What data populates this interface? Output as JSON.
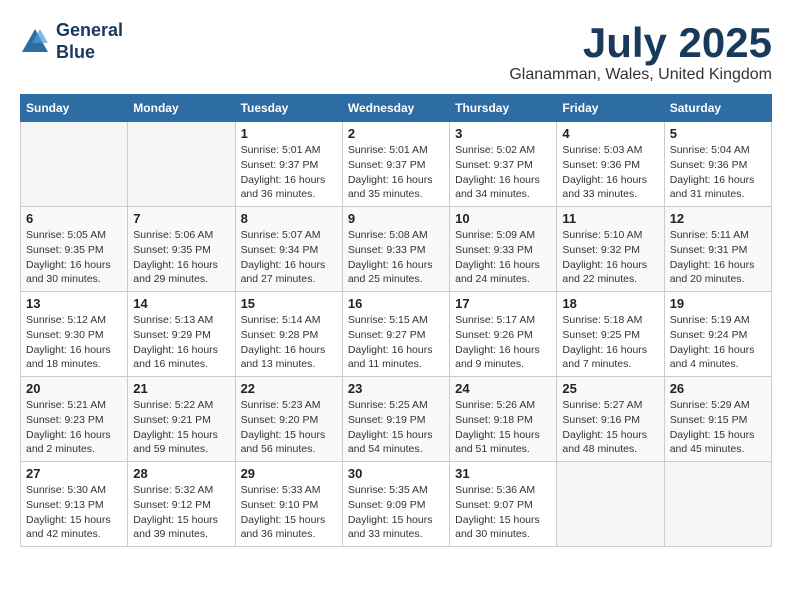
{
  "logo": {
    "line1": "General",
    "line2": "Blue"
  },
  "title": "July 2025",
  "location": "Glanamman, Wales, United Kingdom",
  "headers": [
    "Sunday",
    "Monday",
    "Tuesday",
    "Wednesday",
    "Thursday",
    "Friday",
    "Saturday"
  ],
  "weeks": [
    [
      {
        "day": "",
        "info": ""
      },
      {
        "day": "",
        "info": ""
      },
      {
        "day": "1",
        "info": "Sunrise: 5:01 AM\nSunset: 9:37 PM\nDaylight: 16 hours\nand 36 minutes."
      },
      {
        "day": "2",
        "info": "Sunrise: 5:01 AM\nSunset: 9:37 PM\nDaylight: 16 hours\nand 35 minutes."
      },
      {
        "day": "3",
        "info": "Sunrise: 5:02 AM\nSunset: 9:37 PM\nDaylight: 16 hours\nand 34 minutes."
      },
      {
        "day": "4",
        "info": "Sunrise: 5:03 AM\nSunset: 9:36 PM\nDaylight: 16 hours\nand 33 minutes."
      },
      {
        "day": "5",
        "info": "Sunrise: 5:04 AM\nSunset: 9:36 PM\nDaylight: 16 hours\nand 31 minutes."
      }
    ],
    [
      {
        "day": "6",
        "info": "Sunrise: 5:05 AM\nSunset: 9:35 PM\nDaylight: 16 hours\nand 30 minutes."
      },
      {
        "day": "7",
        "info": "Sunrise: 5:06 AM\nSunset: 9:35 PM\nDaylight: 16 hours\nand 29 minutes."
      },
      {
        "day": "8",
        "info": "Sunrise: 5:07 AM\nSunset: 9:34 PM\nDaylight: 16 hours\nand 27 minutes."
      },
      {
        "day": "9",
        "info": "Sunrise: 5:08 AM\nSunset: 9:33 PM\nDaylight: 16 hours\nand 25 minutes."
      },
      {
        "day": "10",
        "info": "Sunrise: 5:09 AM\nSunset: 9:33 PM\nDaylight: 16 hours\nand 24 minutes."
      },
      {
        "day": "11",
        "info": "Sunrise: 5:10 AM\nSunset: 9:32 PM\nDaylight: 16 hours\nand 22 minutes."
      },
      {
        "day": "12",
        "info": "Sunrise: 5:11 AM\nSunset: 9:31 PM\nDaylight: 16 hours\nand 20 minutes."
      }
    ],
    [
      {
        "day": "13",
        "info": "Sunrise: 5:12 AM\nSunset: 9:30 PM\nDaylight: 16 hours\nand 18 minutes."
      },
      {
        "day": "14",
        "info": "Sunrise: 5:13 AM\nSunset: 9:29 PM\nDaylight: 16 hours\nand 16 minutes."
      },
      {
        "day": "15",
        "info": "Sunrise: 5:14 AM\nSunset: 9:28 PM\nDaylight: 16 hours\nand 13 minutes."
      },
      {
        "day": "16",
        "info": "Sunrise: 5:15 AM\nSunset: 9:27 PM\nDaylight: 16 hours\nand 11 minutes."
      },
      {
        "day": "17",
        "info": "Sunrise: 5:17 AM\nSunset: 9:26 PM\nDaylight: 16 hours\nand 9 minutes."
      },
      {
        "day": "18",
        "info": "Sunrise: 5:18 AM\nSunset: 9:25 PM\nDaylight: 16 hours\nand 7 minutes."
      },
      {
        "day": "19",
        "info": "Sunrise: 5:19 AM\nSunset: 9:24 PM\nDaylight: 16 hours\nand 4 minutes."
      }
    ],
    [
      {
        "day": "20",
        "info": "Sunrise: 5:21 AM\nSunset: 9:23 PM\nDaylight: 16 hours\nand 2 minutes."
      },
      {
        "day": "21",
        "info": "Sunrise: 5:22 AM\nSunset: 9:21 PM\nDaylight: 15 hours\nand 59 minutes."
      },
      {
        "day": "22",
        "info": "Sunrise: 5:23 AM\nSunset: 9:20 PM\nDaylight: 15 hours\nand 56 minutes."
      },
      {
        "day": "23",
        "info": "Sunrise: 5:25 AM\nSunset: 9:19 PM\nDaylight: 15 hours\nand 54 minutes."
      },
      {
        "day": "24",
        "info": "Sunrise: 5:26 AM\nSunset: 9:18 PM\nDaylight: 15 hours\nand 51 minutes."
      },
      {
        "day": "25",
        "info": "Sunrise: 5:27 AM\nSunset: 9:16 PM\nDaylight: 15 hours\nand 48 minutes."
      },
      {
        "day": "26",
        "info": "Sunrise: 5:29 AM\nSunset: 9:15 PM\nDaylight: 15 hours\nand 45 minutes."
      }
    ],
    [
      {
        "day": "27",
        "info": "Sunrise: 5:30 AM\nSunset: 9:13 PM\nDaylight: 15 hours\nand 42 minutes."
      },
      {
        "day": "28",
        "info": "Sunrise: 5:32 AM\nSunset: 9:12 PM\nDaylight: 15 hours\nand 39 minutes."
      },
      {
        "day": "29",
        "info": "Sunrise: 5:33 AM\nSunset: 9:10 PM\nDaylight: 15 hours\nand 36 minutes."
      },
      {
        "day": "30",
        "info": "Sunrise: 5:35 AM\nSunset: 9:09 PM\nDaylight: 15 hours\nand 33 minutes."
      },
      {
        "day": "31",
        "info": "Sunrise: 5:36 AM\nSunset: 9:07 PM\nDaylight: 15 hours\nand 30 minutes."
      },
      {
        "day": "",
        "info": ""
      },
      {
        "day": "",
        "info": ""
      }
    ]
  ]
}
